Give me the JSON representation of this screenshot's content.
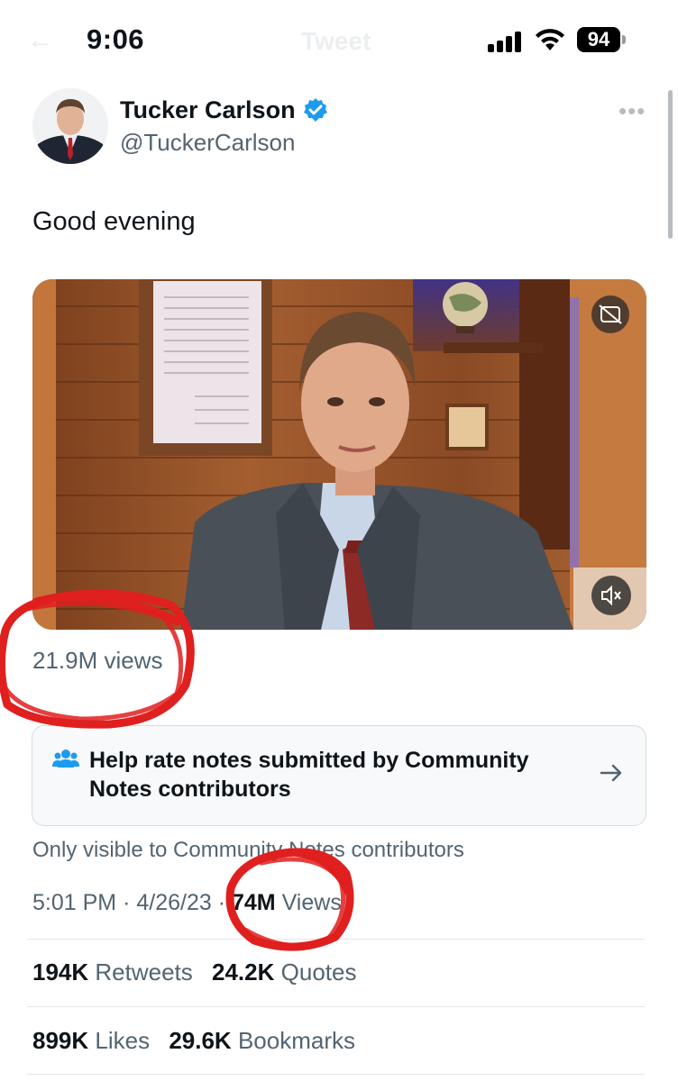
{
  "status_bar": {
    "time": "9:06",
    "battery": "94",
    "ghost_title": "Tweet"
  },
  "author": {
    "name": "Tucker Carlson",
    "handle": "@TuckerCarlson",
    "verified_color": "#1d9bf0"
  },
  "tweet": {
    "text": "Good evening",
    "media_views": "21.9M views"
  },
  "community_notes": {
    "prompt": "Help rate notes submitted by Community Notes contributors",
    "visibility": "Only visible to Community Notes contributors"
  },
  "meta": {
    "time": "5:01 PM",
    "separator": "·",
    "date": "4/26/23",
    "views_count": "74M",
    "views_label": "Views"
  },
  "stats": {
    "retweets_count": "194K",
    "retweets_label": "Retweets",
    "quotes_count": "24.2K",
    "quotes_label": "Quotes",
    "likes_count": "899K",
    "likes_label": "Likes",
    "bookmarks_count": "29.6K",
    "bookmarks_label": "Bookmarks"
  },
  "annotations": {
    "color": "#e01f1f",
    "circled": [
      "21.9M views",
      "74M Views"
    ]
  },
  "colors": {
    "text": "#0f1419",
    "secondary": "#536471",
    "accent": "#1d9bf0"
  }
}
